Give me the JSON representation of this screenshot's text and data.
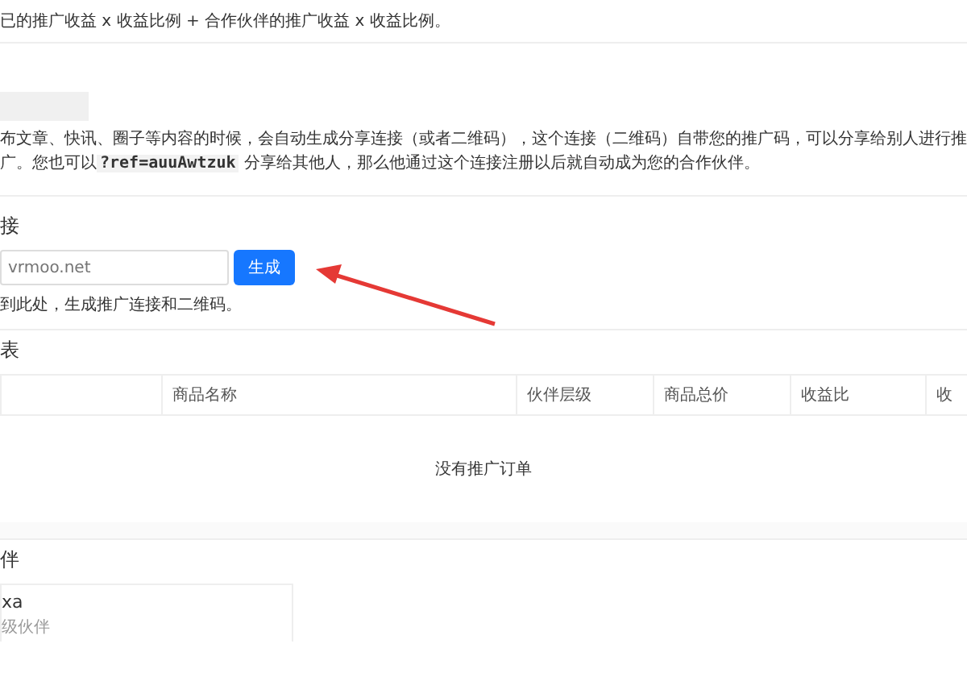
{
  "top_note": "已的推广收益 x 收益比例 + 合作伙伴的推广收益 x 收益比例。",
  "intro": {
    "paragraph": "布文章、快讯、圈子等内容的时候，会自动生成分享连接（或者二维码），这个连接（二维码）自带您的推广码，可以分享给别人进行推广。您也可以",
    "code": "?ref=auuAwtzuk",
    "paragraph_end": "分享给其他人，那么他通过这个连接注册以后就自动成为您的合作伙伴。"
  },
  "generator": {
    "title": "接",
    "placeholder": "vrmoo.net",
    "button": "生成",
    "hint": "到此处，生成推广连接和二维码。"
  },
  "orders": {
    "title": "表",
    "columns": [
      "",
      "商品名称",
      "伙伴层级",
      "商品总价",
      "收益比",
      "收"
    ],
    "empty": "没有推广订单"
  },
  "partners": {
    "title": "伴",
    "items": [
      {
        "name": "xa",
        "level": "级伙伴"
      }
    ]
  }
}
